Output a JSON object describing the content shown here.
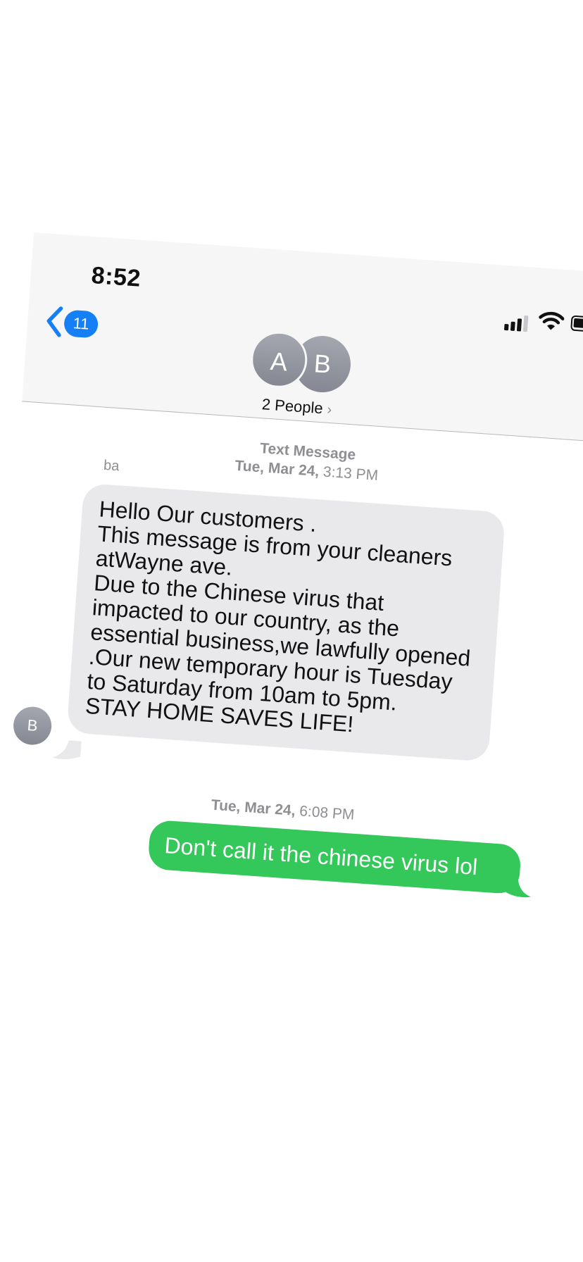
{
  "status_bar": {
    "time": "8:52"
  },
  "header": {
    "unread_count": "11",
    "avatars": [
      "A",
      "B"
    ],
    "title": "2 People",
    "title_chevron": "›"
  },
  "conversation": {
    "header_timestamp": {
      "service": "Text Message",
      "day": "Tue, Mar 24,",
      "time": "3:13 PM"
    },
    "messages": [
      {
        "direction": "incoming",
        "sender_label": "ba",
        "sender_initial": "B",
        "text": "Hello Our customers .\nThis message is from your cleaners atWayne ave.\nDue to the Chinese virus that impacted to our country, as the essential business,we lawfully opened .Our new temporary hour is Tuesday to Saturday from 10am to 5pm.\nSTAY HOME SAVES LIFE!"
      },
      {
        "direction": "outgoing",
        "timestamp": {
          "day": "Tue, Mar 24,",
          "time": "6:08 PM"
        },
        "text": "Don't call it the chinese virus lol"
      }
    ]
  },
  "colors": {
    "header_bg": "#f6f6f6",
    "accent_blue": "#1580f5",
    "incoming_bubble": "#e9e9eb",
    "outgoing_bubble": "#34c759",
    "timestamp_gray": "#8e8e93"
  },
  "icons": [
    "chevron-left-icon",
    "signal-icon",
    "wifi-icon",
    "battery-icon",
    "chevron-right-icon"
  ]
}
